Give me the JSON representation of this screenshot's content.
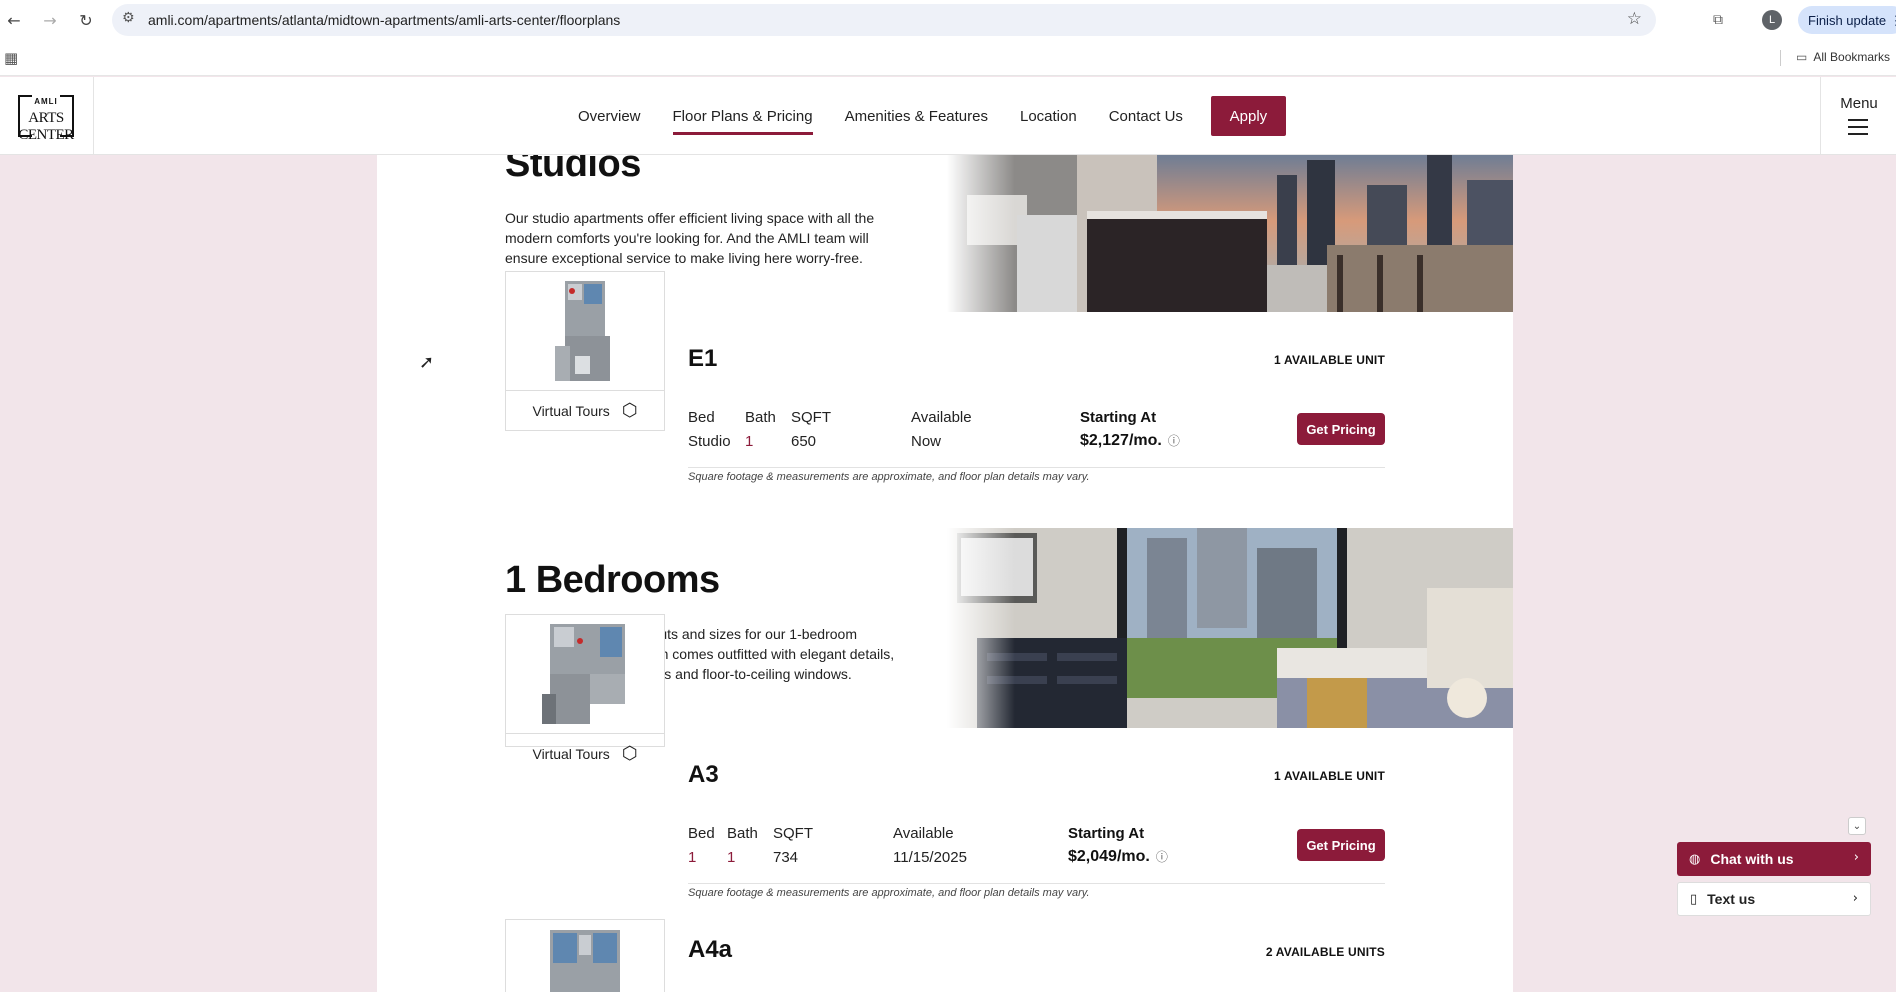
{
  "browser": {
    "url": "amli.com/apartments/atlanta/midtown-apartments/amli-arts-center/floorplans",
    "avatar_initial": "L",
    "finish_update": "Finish update",
    "all_bookmarks": "All Bookmarks"
  },
  "site": {
    "logo_small": "AMLI",
    "logo_big": "ARTS CENTER",
    "nav": [
      {
        "label": "Overview",
        "active": false
      },
      {
        "label": "Floor Plans & Pricing",
        "active": true
      },
      {
        "label": "Amenities & Features",
        "active": false
      },
      {
        "label": "Location",
        "active": false
      },
      {
        "label": "Contact Us",
        "active": false
      }
    ],
    "apply_label": "Apply",
    "menu_label": "Menu",
    "brand_color": "#8c1b3a"
  },
  "sections": {
    "studios": {
      "title": "Studios",
      "description": "Our studio apartments offer efficient living space with all the modern comforts you're looking for. And the AMLI team will ensure exceptional service to make living here worry-free."
    },
    "one_bed": {
      "title": "1 Bedrooms",
      "description": "We offer a variety of layouts and sizes for our 1-bedroom apartments, each of which comes outfitted with elegant details, energy-efficient appliances and floor-to-ceiling windows."
    }
  },
  "labels": {
    "virtual_tours": "Virtual Tours",
    "bed": "Bed",
    "bath": "Bath",
    "sqft": "SQFT",
    "available": "Available",
    "starting_at": "Starting At",
    "get_pricing": "Get Pricing",
    "disclaimer": "Square footage & measurements are approximate, and floor plan details may vary."
  },
  "plans": {
    "e1": {
      "name": "E1",
      "available_units": "1 AVAILABLE UNIT",
      "bed": "Studio",
      "bath": "1",
      "sqft": "650",
      "available": "Now",
      "price": "$2,127/mo."
    },
    "a3": {
      "name": "A3",
      "available_units": "1 AVAILABLE UNIT",
      "bed": "1",
      "bath": "1",
      "sqft": "734",
      "available": "11/15/2025",
      "price": "$2,049/mo."
    },
    "a4a": {
      "name": "A4a",
      "available_units": "2 AVAILABLE UNITS"
    }
  },
  "chat": {
    "chat_label": "Chat with us",
    "text_label": "Text us"
  }
}
